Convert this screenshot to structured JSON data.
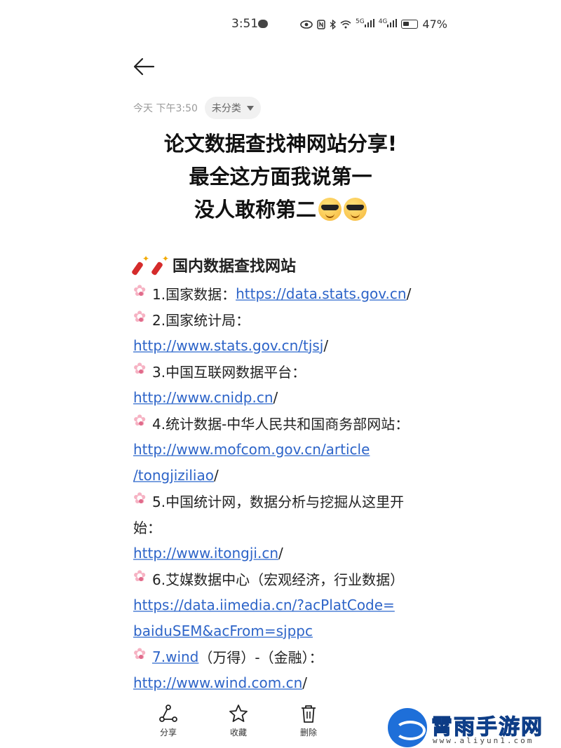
{
  "status_bar": {
    "time": "3:51",
    "signal_1": "5G",
    "signal_2": "4G",
    "battery": "47%"
  },
  "note": {
    "timestamp": "今天 下午3:50",
    "category": "未分类",
    "title_lines": [
      "论文数据查找神网站分享!",
      "最全这方面我说第一",
      "没人敢称第二"
    ],
    "section_heading": "国内数据查找网站",
    "items": {
      "i1_label": "1.国家数据：",
      "i1_link": "https://data.stats.gov.cn",
      "i2_label": "2.国家统计局：",
      "i2_link": "http://www.stats.gov.cn/tjsj",
      "i3_label": "3.中国互联网数据平台：",
      "i3_link": "http://www.cnidp.cn",
      "i4_label": "4.统计数据-中华人民共和国商务部网站：",
      "i4_link_a": "http://www.mofcom.gov.cn/article",
      "i4_link_b": "/tongjiziliao",
      "i5_label_a": "5.中国统计网，数据分析与挖掘从这里开",
      "i5_label_b": "始：",
      "i5_link": "http://www.itongji.cn",
      "i6_label": "6.艾媒数据中心（宏观经济，行业数据）",
      "i6_link_a": "https://data.iimedia.cn/?acPlatCode=",
      "i6_link_b": "baiduSEM&acFrom=sjppc",
      "i7_link": "7.wind",
      "i7_label": "（万得）-（金融）：",
      "i7_url": "http://www.wind.com.cn",
      "slash": "/"
    }
  },
  "actions": {
    "share": "分享",
    "favorite": "收藏",
    "delete": "删除"
  },
  "watermark": {
    "name": "霄雨手游网",
    "url": "www.aliyun1.com"
  },
  "icons": [
    "message-icon",
    "eye-icon",
    "nfc-icon",
    "bluetooth-icon",
    "wifi-icon",
    "signal-icon",
    "battery-icon",
    "back-arrow-icon",
    "caret-down-icon",
    "sunglasses-emoji-icon",
    "firecracker-emoji-icon",
    "cherry-blossom-icon",
    "share-icon",
    "star-icon",
    "trash-icon"
  ]
}
